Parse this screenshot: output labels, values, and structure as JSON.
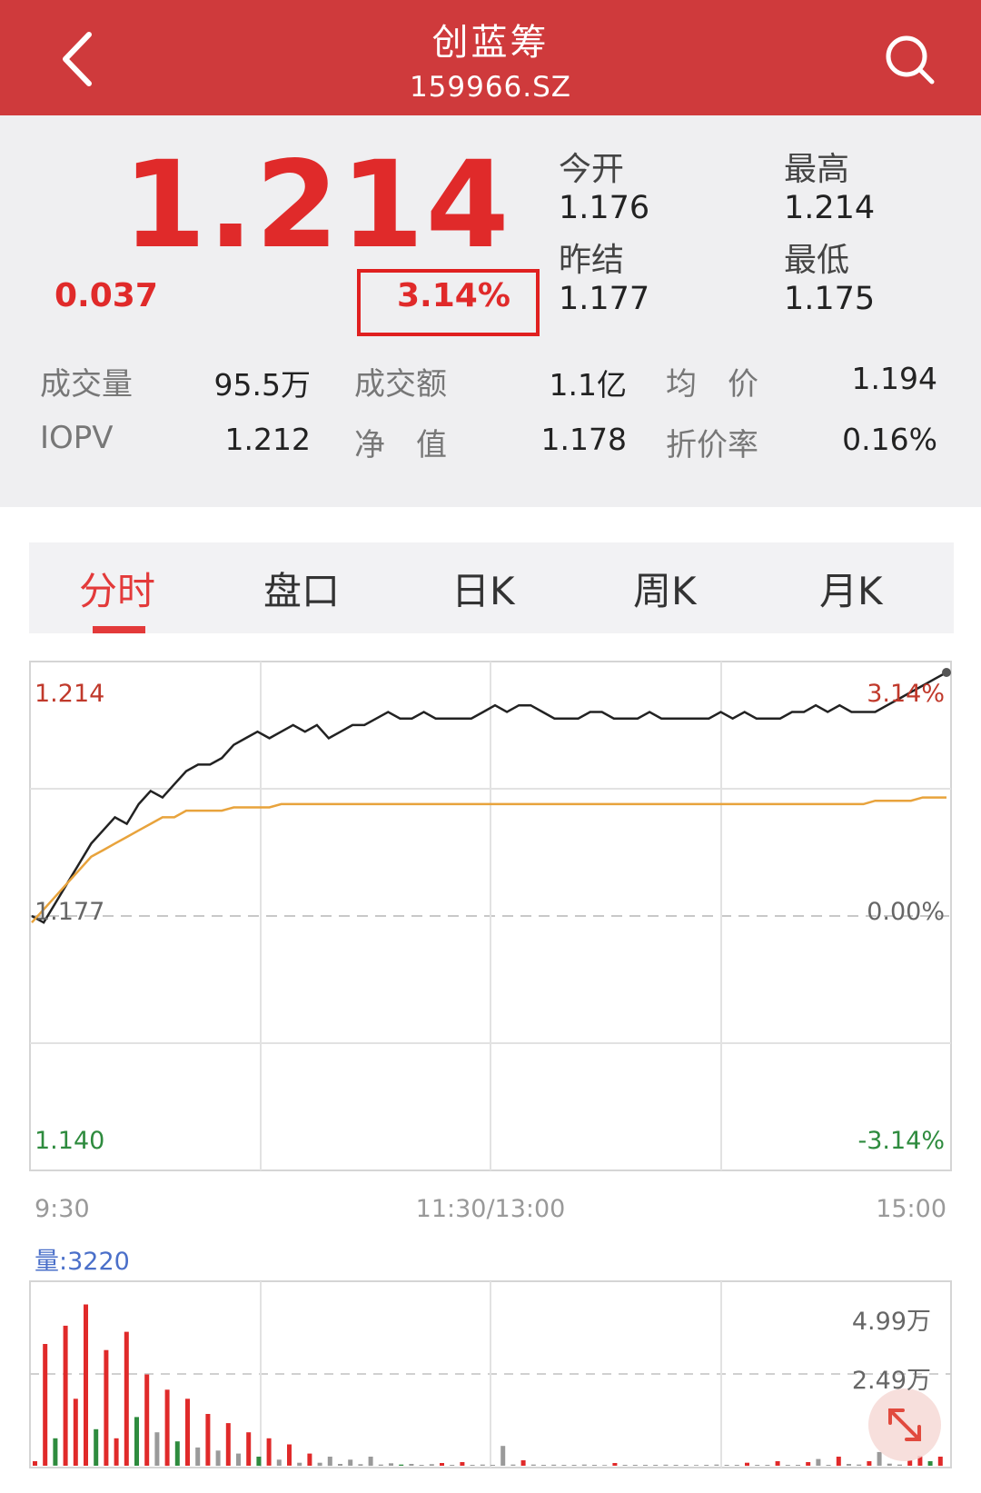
{
  "header": {
    "title": "创蓝筹",
    "code": "159966.SZ"
  },
  "quote": {
    "price": "1.214",
    "change": "0.037",
    "change_pct": "3.14%",
    "stats": [
      {
        "label": "今开",
        "value": "1.176"
      },
      {
        "label": "最高",
        "value": "1.214"
      },
      {
        "label": "昨结",
        "value": "1.177"
      },
      {
        "label": "最低",
        "value": "1.175"
      }
    ],
    "rows": [
      [
        {
          "label": "成交量",
          "value": "95.5万"
        },
        {
          "label": "成交额",
          "value": "1.1亿"
        },
        {
          "label": "均　价",
          "value": "1.194"
        }
      ],
      [
        {
          "label": "IOPV",
          "value": "1.212"
        },
        {
          "label": "净　值",
          "value": "1.178"
        },
        {
          "label": "折价率",
          "value": "0.16%"
        }
      ]
    ]
  },
  "tabs": [
    {
      "label": "分时",
      "active": true
    },
    {
      "label": "盘口",
      "active": false
    },
    {
      "label": "日K",
      "active": false
    },
    {
      "label": "周K",
      "active": false
    },
    {
      "label": "月K",
      "active": false
    }
  ],
  "colors": {
    "brand": "#cf3a3c",
    "up": "#e02a2a",
    "down": "#2e8b3e",
    "avg_line": "#e8a33c",
    "price_line": "#222222",
    "volume_label": "#4a6fc9"
  },
  "chart_data": [
    {
      "type": "line",
      "y_labels_left": {
        "top": "1.214",
        "mid": "1.177",
        "bottom": "1.140"
      },
      "y_labels_right": {
        "top": "3.14%",
        "mid": "0.00%",
        "bottom": "-3.14%"
      },
      "x_labels": [
        "9:30",
        "11:30/13:00",
        "15:00"
      ],
      "ylim": [
        1.14,
        1.214
      ],
      "grid": true,
      "series": [
        {
          "values": [
            1.177,
            1.176,
            1.179,
            1.182,
            1.185,
            1.188,
            1.19,
            1.192,
            1.191,
            1.194,
            1.196,
            1.195,
            1.197,
            1.199,
            1.2,
            1.2,
            1.201,
            1.203,
            1.204,
            1.205,
            1.204,
            1.205,
            1.206,
            1.205,
            1.206,
            1.204,
            1.205,
            1.206,
            1.206,
            1.207,
            1.208,
            1.207,
            1.207,
            1.208,
            1.207,
            1.207,
            1.207,
            1.207,
            1.208,
            1.209,
            1.208,
            1.209,
            1.209,
            1.208,
            1.207,
            1.207,
            1.207,
            1.208,
            1.208,
            1.207,
            1.207,
            1.207,
            1.208,
            1.207,
            1.207,
            1.207,
            1.207,
            1.207,
            1.208,
            1.207,
            1.208,
            1.207,
            1.207,
            1.207,
            1.208,
            1.208,
            1.209,
            1.208,
            1.209,
            1.208,
            1.208,
            1.208,
            1.209,
            1.21,
            1.211,
            1.212,
            1.213,
            1.214
          ]
        },
        {
          "values": [
            1.176,
            1.178,
            1.18,
            1.182,
            1.184,
            1.186,
            1.187,
            1.188,
            1.189,
            1.19,
            1.191,
            1.192,
            1.192,
            1.193,
            1.193,
            1.193,
            1.193,
            1.1935,
            1.1935,
            1.1935,
            1.1935,
            1.194,
            1.194,
            1.194,
            1.194,
            1.194,
            1.194,
            1.194,
            1.194,
            1.194,
            1.194,
            1.194,
            1.194,
            1.194,
            1.194,
            1.194,
            1.194,
            1.194,
            1.194,
            1.194,
            1.194,
            1.194,
            1.194,
            1.194,
            1.194,
            1.194,
            1.194,
            1.194,
            1.194,
            1.194,
            1.194,
            1.194,
            1.194,
            1.194,
            1.194,
            1.194,
            1.194,
            1.194,
            1.194,
            1.194,
            1.194,
            1.194,
            1.194,
            1.194,
            1.194,
            1.194,
            1.194,
            1.194,
            1.194,
            1.194,
            1.194,
            1.1945,
            1.1945,
            1.1945,
            1.1945,
            1.195,
            1.195,
            1.195
          ]
        }
      ]
    },
    {
      "type": "bar",
      "label": "量:3220",
      "y_labels": [
        "4.99万",
        "2.49万"
      ],
      "ylim": [
        0,
        60000
      ],
      "values": [
        1500,
        40000,
        9000,
        46000,
        22000,
        53000,
        12000,
        38000,
        9000,
        44000,
        16000,
        30000,
        11000,
        25000,
        8000,
        22000,
        6000,
        17000,
        5000,
        14000,
        4000,
        11000,
        3000,
        9000,
        2000,
        7000,
        1000,
        4000,
        1000,
        3000,
        600,
        2000,
        500,
        3000,
        400,
        800,
        400,
        600,
        300,
        500,
        900,
        300,
        1200,
        300,
        400,
        300,
        6500,
        400,
        1800,
        400,
        300,
        350,
        300,
        300,
        400,
        300,
        250,
        900,
        300,
        300,
        300,
        300,
        350,
        300,
        300,
        250,
        300,
        400,
        300,
        300,
        1000,
        300,
        300,
        1500,
        300,
        300,
        1200,
        2200,
        300,
        3000,
        600,
        400,
        1500,
        4500,
        700,
        400,
        1800,
        3200,
        1500,
        3000
      ],
      "colors": [
        "up",
        "up",
        "down",
        "up",
        "up",
        "up",
        "down",
        "up",
        "up",
        "up",
        "down",
        "up",
        "gray",
        "up",
        "down",
        "up",
        "gray",
        "up",
        "gray",
        "up",
        "gray",
        "up",
        "down",
        "up",
        "gray",
        "up",
        "gray",
        "up",
        "gray",
        "gray",
        "gray",
        "gray",
        "gray",
        "gray",
        "gray",
        "gray",
        "down",
        "gray",
        "gray",
        "gray",
        "up",
        "gray",
        "up",
        "gray",
        "gray",
        "gray",
        "gray",
        "gray",
        "up",
        "gray",
        "gray",
        "gray",
        "gray",
        "gray",
        "gray",
        "gray",
        "gray",
        "up",
        "gray",
        "gray",
        "gray",
        "gray",
        "gray",
        "gray",
        "gray",
        "gray",
        "gray",
        "gray",
        "gray",
        "gray",
        "up",
        "gray",
        "gray",
        "up",
        "gray",
        "gray",
        "up",
        "gray",
        "gray",
        "up",
        "gray",
        "gray",
        "up",
        "gray",
        "gray",
        "gray",
        "up",
        "up",
        "down",
        "up"
      ]
    }
  ]
}
